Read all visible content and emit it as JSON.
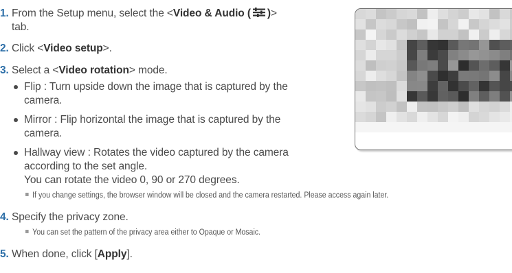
{
  "steps": [
    {
      "number": "1.",
      "pre": "From the Setup menu, select the <",
      "bold": "Video & Audio (",
      "bold_after_icon": ")",
      "post": ">",
      "continuation": "tab.",
      "icon": "video-audio-settings-icon"
    },
    {
      "number": "2.",
      "pre": "Click <",
      "bold": "Video setup",
      "post": ">."
    },
    {
      "number": "3.",
      "pre": "Select a <",
      "bold": "Video rotation",
      "post": "> mode.",
      "bullets": [
        {
          "line1": "Flip : Turn upside down the image that is captured by the",
          "line2": "camera."
        },
        {
          "line1": "Mirror : Flip horizontal the image that is captured by the",
          "line2": "camera."
        },
        {
          "line1": "Hallway view : Rotates the video captured by the camera",
          "line2": "according to the set angle.",
          "line3": "You can rotate the video 0, 90 or 270 degrees."
        }
      ],
      "note": "If you change settings, the browser window will be closed and the camera restarted. Please access again later."
    },
    {
      "number": "4.",
      "text": "Specify the privacy zone.",
      "note": "You can set the pattern of the privacy area either to Opaque or Mosaic."
    },
    {
      "number": "5.",
      "pre": "When done, click [",
      "bold": "Apply",
      "post": "]."
    }
  ],
  "figure": {
    "description_icon": "mosaic-privacy-zone-screenshot",
    "colors": {
      "frame": "#6f6f6f",
      "accent_number": "#2d6fa8"
    }
  }
}
